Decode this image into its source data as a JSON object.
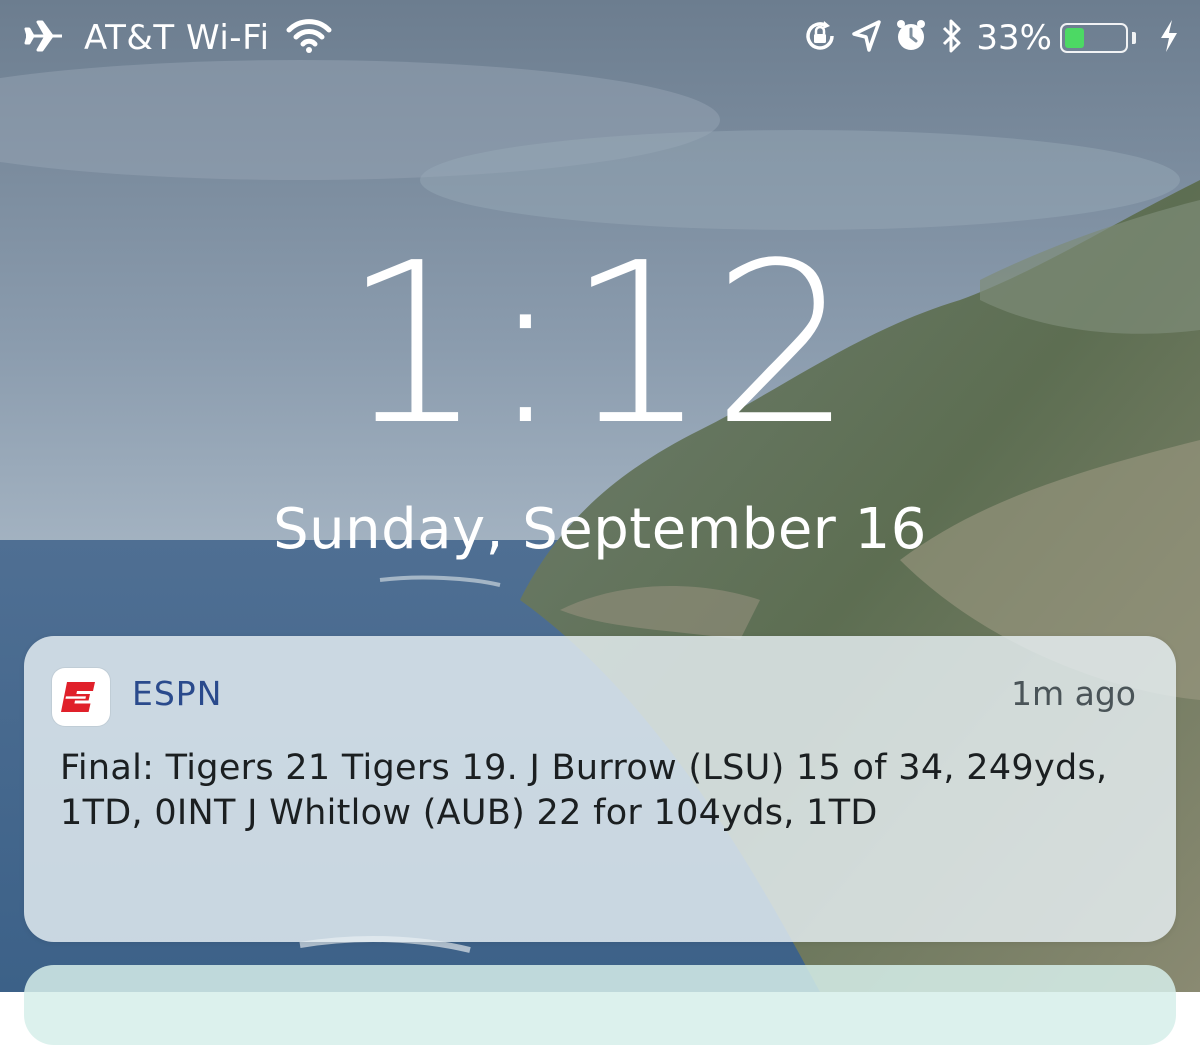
{
  "status_bar": {
    "carrier": "AT&T Wi-Fi",
    "battery_percent": "33%",
    "battery_level": 0.33,
    "icons": [
      "airplane-icon",
      "wifi-icon",
      "rotation-lock-icon",
      "location-icon",
      "alarm-icon",
      "bluetooth-icon",
      "battery-icon",
      "charging-bolt-icon"
    ]
  },
  "lock_screen": {
    "time": "1:12",
    "date": "Sunday, September 16"
  },
  "notification": {
    "app_name": "ESPN",
    "time_ago": "1m ago",
    "body": "Final: Tigers 21 Tigers 19. J Burrow (LSU) 15 of 34, 249yds, 1TD, 0INT J Whitlow (AUB) 22 for 104yds, 1TD"
  },
  "colors": {
    "battery_fill": "#4cd964",
    "espn_red": "#e0202a",
    "app_name": "#2a4a8c"
  }
}
